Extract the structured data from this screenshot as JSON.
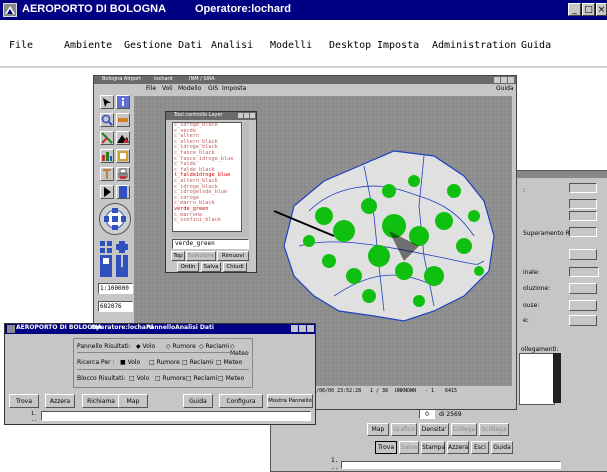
{
  "app": {
    "title": "AEROPORTO DI BOLOGNA",
    "operator": "Operatore:lochard"
  },
  "menu": [
    "File",
    "Ambiente",
    "Gestione Dati",
    "Analisi",
    "Modelli",
    "Desktop",
    "Imposta",
    "Administration",
    "Guida"
  ],
  "gis": {
    "title": "Bologna Airport",
    "operator": "lochard",
    "module": "INM / SIRA",
    "menu": [
      "File",
      "Voli",
      "Modello",
      "GIS",
      "Imposta"
    ],
    "menu_right": "Guida",
    "scale": "1:100000",
    "coord": "682076",
    "status": [
      "04/06/00 23:52:28",
      "1 / 38",
      "UNKNOWN",
      "- 1",
      "6415"
    ]
  },
  "layers": {
    "title": "Tool controllo Layer",
    "items": [
      {
        "label": "c_idroge_black",
        "color": "#c06060"
      },
      {
        "label": "c_verde",
        "color": "#c06060"
      },
      {
        "label": "c_altern",
        "color": "#c06060"
      },
      {
        "label": "c_altern_black",
        "color": "#c06060"
      },
      {
        "label": "c_idroge_black",
        "color": "#c06060"
      },
      {
        "label": "c_fasce_black",
        "color": "#c06060"
      },
      {
        "label": "c_fasce_idroge_blue",
        "color": "#c06060"
      },
      {
        "label": "c_falde",
        "color": "#c06060"
      },
      {
        "label": "c_falde_black",
        "color": "#c06060"
      },
      {
        "label": "t_faldeidroge_blue",
        "color": "#d00000"
      },
      {
        "label": "c_altern_black",
        "color": "#c06060"
      },
      {
        "label": "c_idroge_black",
        "color": "#c06060"
      },
      {
        "label": "c_idrogelsde_blue",
        "color": "#c06060"
      },
      {
        "label": "c_idroge",
        "color": "#c06060"
      },
      {
        "label": "c_marro_black",
        "color": "#c06060"
      },
      {
        "label": "verde_green",
        "color": "#d00000"
      },
      {
        "label": "c_marrone",
        "color": "#c06060"
      },
      {
        "label": "c_confini_black",
        "color": "#c06060"
      }
    ],
    "selected": "verde_green",
    "buttons": [
      "Top",
      "Selezione",
      "Rimuovi",
      "Ordin",
      "Salva",
      "Chiudi"
    ]
  },
  "analisi": {
    "title_app": "AEROPORTO DI BOLOGNA",
    "title_op": "Operatore:lochard",
    "title_panel": "PannelloAnalisi Dati",
    "pannello_label": "Pannello Risultati:",
    "pannello_opts": [
      "Volo",
      "Rumore",
      "Reclami",
      "Meteo"
    ],
    "ricerca_label": "Ricerca Per :",
    "ricerca_opts": [
      "Volo",
      "Rumore",
      "Reclami",
      "Meteo"
    ],
    "blocco_label": "Blocco Risultati:",
    "blocco_opts": [
      "Volo",
      "Rumore",
      "Reclami",
      "Meteo"
    ],
    "buttons": [
      "Trova",
      "Azzera",
      "Richiama",
      "Map",
      "Guida",
      "Configura",
      "Mostra Pannello"
    ],
    "line1": "1.",
    "line2": ".."
  },
  "right_panel": {
    "labels": [
      ":",
      "Superamento Rumore:",
      "inale:",
      "oluzione:",
      "ouse:",
      "e:"
    ],
    "collegamenti": "ollegamenti:",
    "page_value": "0",
    "page_of": "di 2569",
    "buttons_row1": [
      "Map",
      "Grafico",
      "Densita'",
      "Collega",
      "Scollega"
    ],
    "buttons_row2": [
      "Trova",
      "Salva",
      "Stampa",
      "Azzera",
      "Esci",
      "Guida"
    ],
    "line1": "1.",
    "line2": ".."
  }
}
